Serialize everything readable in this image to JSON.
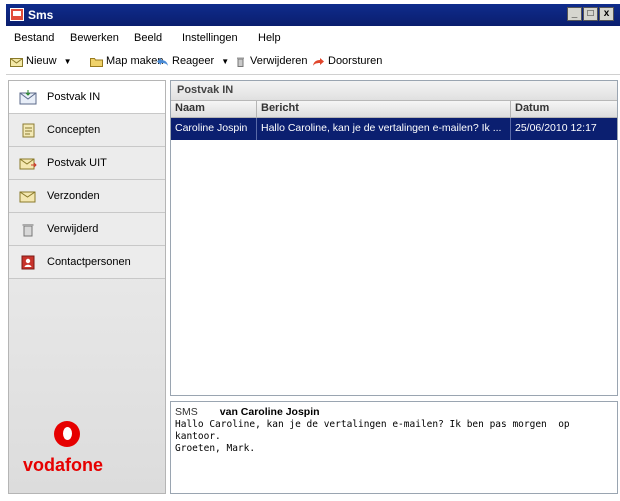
{
  "window": {
    "title": "Sms",
    "minimize": "_",
    "maximize": "□",
    "close": "x"
  },
  "menu": [
    "Bestand",
    "Bewerken",
    "Beeld",
    "Instellingen",
    "Help"
  ],
  "toolbar": {
    "new": "Nieuw",
    "new_folder": "Map maken",
    "reply": "Reageer",
    "delete": "Verwijderen",
    "forward": "Doorsturen"
  },
  "sidebar": {
    "items": [
      {
        "label": "Postvak IN",
        "icon": "inbox-icon"
      },
      {
        "label": "Concepten",
        "icon": "drafts-icon"
      },
      {
        "label": "Postvak UIT",
        "icon": "outbox-icon"
      },
      {
        "label": "Verzonden",
        "icon": "sent-icon"
      },
      {
        "label": "Verwijderd",
        "icon": "trash-icon"
      },
      {
        "label": "Contactpersonen",
        "icon": "contacts-icon"
      }
    ],
    "brand": "vodafone",
    "brand_color": "#e60000"
  },
  "list": {
    "folder": "Postvak IN",
    "columns": [
      "Naam",
      "Bericht",
      "Datum"
    ],
    "rows": [
      {
        "name": "Caroline Jospin",
        "message": "Hallo Caroline, kan je de vertalingen e-mailen? Ik ...",
        "date": "25/06/2010 12:17"
      }
    ]
  },
  "preview": {
    "label": "SMS",
    "from": "van Caroline Jospin",
    "body": "Hallo Caroline, kan je de vertalingen e-mailen? Ik ben pas morgen  op kantoor.\nGroeten, Mark."
  }
}
